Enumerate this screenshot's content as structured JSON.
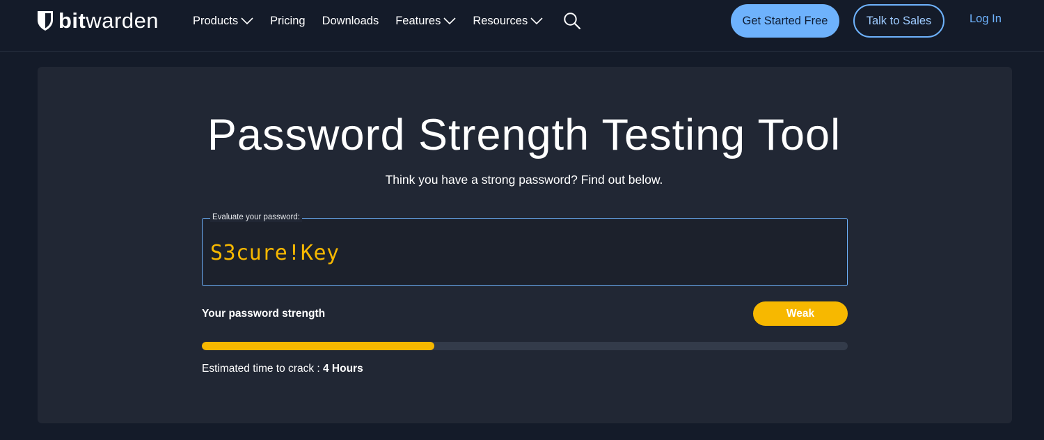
{
  "header": {
    "logo": {
      "bold": "bit",
      "regular": "warden"
    },
    "nav": [
      {
        "label": "Products",
        "has_dropdown": true
      },
      {
        "label": "Pricing",
        "has_dropdown": false
      },
      {
        "label": "Downloads",
        "has_dropdown": false
      },
      {
        "label": "Features",
        "has_dropdown": true
      },
      {
        "label": "Resources",
        "has_dropdown": true
      }
    ],
    "search_icon": "search-icon",
    "cta_primary": "Get Started Free",
    "cta_secondary": "Talk to Sales",
    "login": "Log In"
  },
  "main": {
    "title": "Password Strength Testing Tool",
    "subtitle": "Think you have a strong password? Find out below.",
    "field_label": "Evaluate your password:",
    "password_value": "S3cure!Key",
    "strength_label": "Your password strength",
    "strength_badge": "Weak",
    "strength_fraction": 0.36,
    "crack_label": "Estimated time to crack : ",
    "crack_value": "4 Hours"
  },
  "colors": {
    "background": "#141b29",
    "card": "#212734",
    "accent_blue": "#6eb2fc",
    "weak_yellow": "#f7b800",
    "bar_track": "#333b4a"
  }
}
